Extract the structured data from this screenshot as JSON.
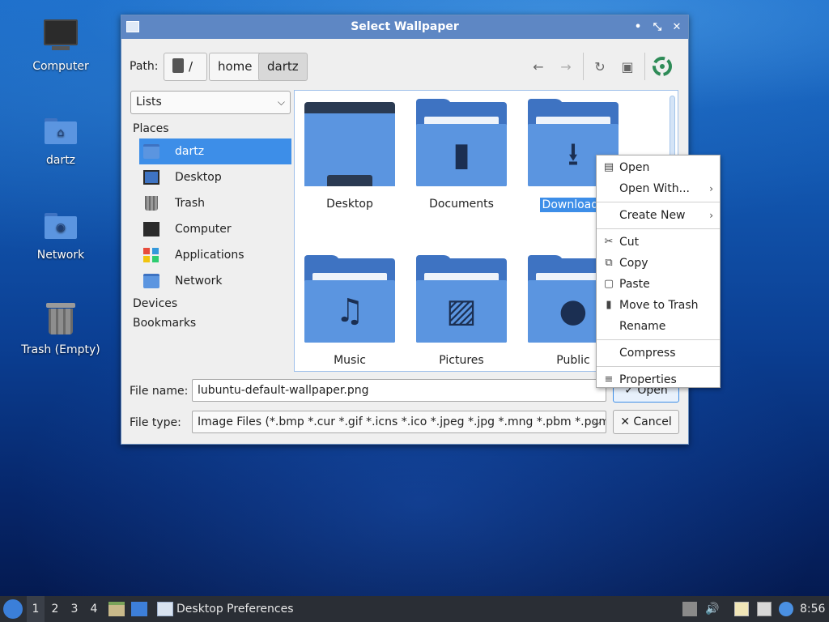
{
  "desktop": {
    "icons": [
      {
        "label": "Computer"
      },
      {
        "label": "dartz"
      },
      {
        "label": "Network"
      },
      {
        "label": "Trash (Empty)"
      }
    ]
  },
  "dialog": {
    "title": "Select Wallpaper",
    "path_label": "Path:",
    "breadcrumbs": [
      "/",
      "home",
      "dartz"
    ],
    "view_mode": "Lists",
    "places_header": "Places",
    "places": [
      "dartz",
      "Desktop",
      "Trash",
      "Computer",
      "Applications",
      "Network"
    ],
    "devices_header": "Devices",
    "bookmarks_header": "Bookmarks",
    "files": [
      "Desktop",
      "Documents",
      "Downloads",
      "Music",
      "Pictures",
      "Public"
    ],
    "file_name_label": "File name:",
    "file_name_value": "lubuntu-default-wallpaper.png",
    "file_type_label": "File type:",
    "file_type_value": "Image Files (*.bmp *.cur *.gif *.icns *.ico *.jpeg *.jpg *.mng *.pbm *.pgm",
    "open_label": "Open",
    "cancel_label": "Cancel"
  },
  "context_menu": {
    "items": [
      "Open",
      "Open With...",
      "Create New",
      "Cut",
      "Copy",
      "Paste",
      "Move to Trash",
      "Rename",
      "Compress",
      "Properties"
    ]
  },
  "taskbar": {
    "workspaces": [
      "1",
      "2",
      "3",
      "4"
    ],
    "task_label": "Desktop Preferences",
    "clock": "8:56"
  },
  "colors": {
    "accent": "#3d8ee8",
    "titlebar": "#5e87c4",
    "folder": "#5b95e0"
  }
}
